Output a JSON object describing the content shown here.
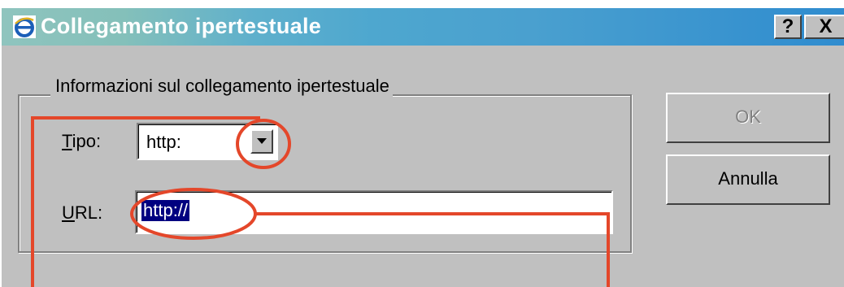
{
  "dialog": {
    "title": "Collegamento ipertestuale",
    "icon": "ie-logo-icon",
    "help_button": "?",
    "close_button": "X"
  },
  "group": {
    "legend": "Informazioni sul collegamento ipertestuale"
  },
  "form": {
    "type_label_mnemonic": "T",
    "type_label_rest": "ipo:",
    "type_value": "http:",
    "url_label_mnemonic": "U",
    "url_label_rest": "RL:",
    "url_value": "http://"
  },
  "buttons": {
    "ok": "OK",
    "cancel": "Annulla"
  },
  "colors": {
    "dialog_face": "#c0c0c0",
    "annotation": "#e4472a",
    "selection": "#000080"
  }
}
